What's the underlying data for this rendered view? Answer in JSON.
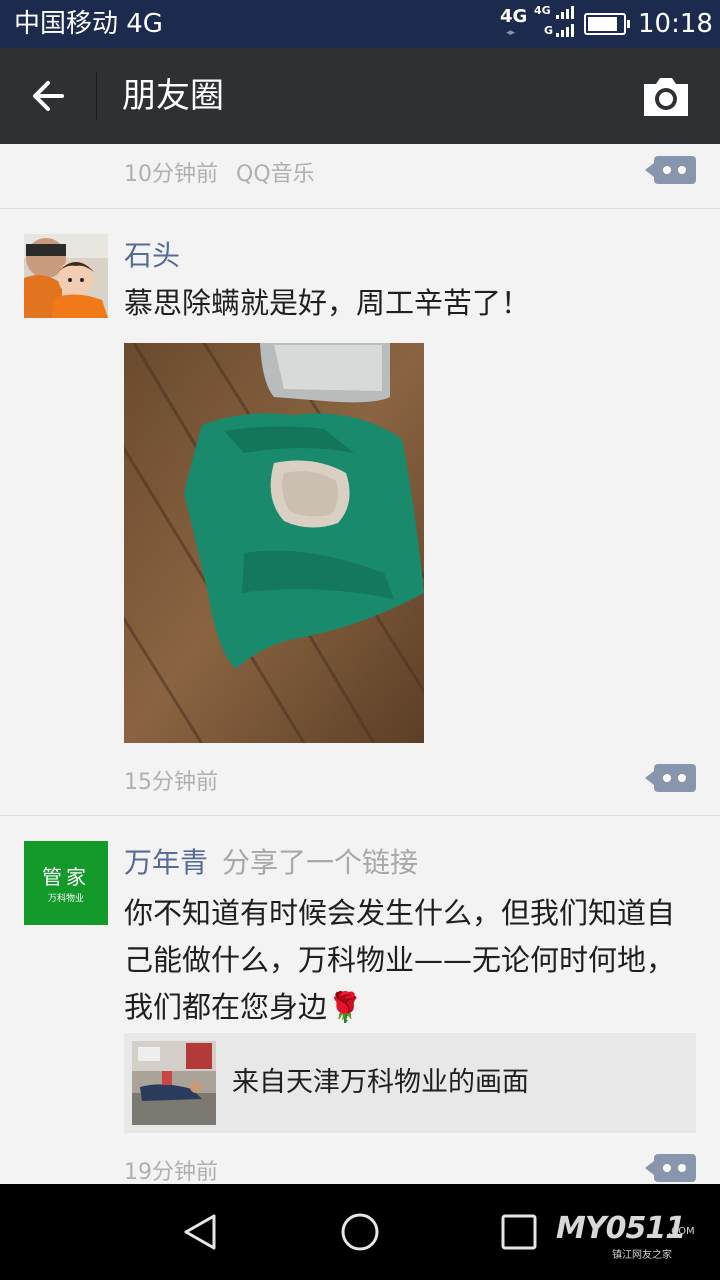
{
  "status_bar": {
    "carrier": "中国移动 4G",
    "network_primary": "4G",
    "network_secondary_top": "4G",
    "network_secondary_bottom": "G",
    "time": "10:18"
  },
  "title_bar": {
    "title": "朋友圈",
    "back_icon": "arrow-left-icon",
    "camera_icon": "camera-icon"
  },
  "feed": {
    "top_partial_post": {
      "time": "10分钟前",
      "source": "QQ音乐"
    },
    "posts": [
      {
        "author": "石头",
        "text": "慕思除螨就是好，周工辛苦了！",
        "time": "15分钟前",
        "has_photo": true
      },
      {
        "author": "万年青",
        "action": "分享了一个链接",
        "text_lines": [
          "你不知道有时候会发生什么，但我们知道自",
          "己能做什么，万科物业——无论何时何地，",
          "我们都在您身边🌹"
        ],
        "avatar_text_top": "管家",
        "avatar_text_bottom": "万科物业",
        "link_title": "来自天津万科物业的画面",
        "time": "19分钟前"
      }
    ]
  },
  "nav_bar": {
    "back_icon": "triangle-back-icon",
    "home_icon": "circle-home-icon",
    "recents_icon": "square-recents-icon",
    "watermark_text": "MY0511",
    "watermark_domain": ".COM",
    "watermark_sub": "镇江网友之家"
  },
  "colors": {
    "status_bar": "#1c2a4e",
    "title_bar": "#2e3134",
    "name_link": "#576b95",
    "meta_gray": "#b0b0b0",
    "more_button": "#8795ad",
    "avatar_green": "#139a2a"
  }
}
